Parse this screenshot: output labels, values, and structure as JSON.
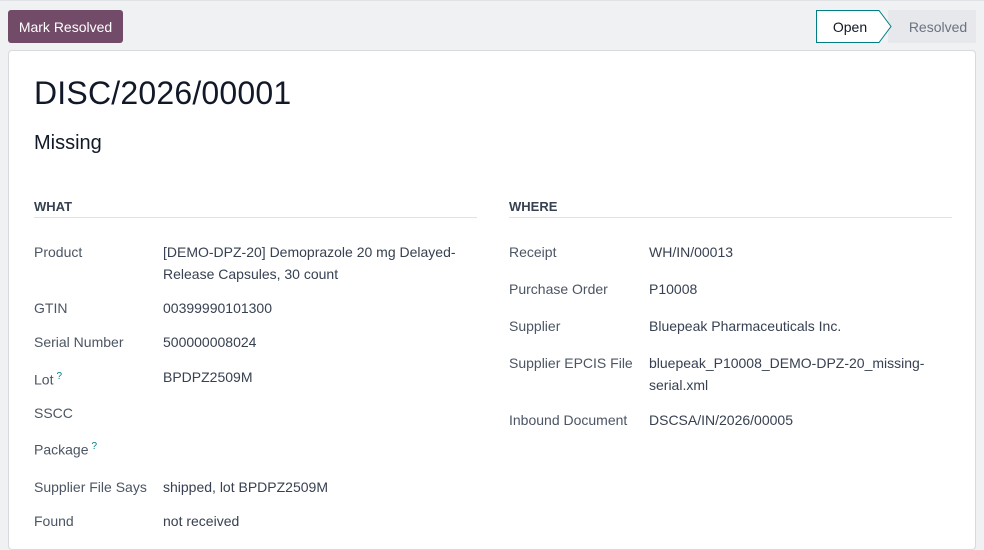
{
  "toolbar": {
    "mark_resolved_label": "Mark Resolved",
    "status": {
      "open": "Open",
      "resolved": "Resolved"
    }
  },
  "record": {
    "title": "DISC/2026/00001",
    "subtitle": "Missing"
  },
  "what": {
    "heading": "WHAT",
    "product_label": "Product",
    "product_value": "[DEMO-DPZ-20] Demoprazole 20 mg Delayed-Release Capsules, 30 count",
    "gtin_label": "GTIN",
    "gtin_value": "00399990101300",
    "serial_label": "Serial Number",
    "serial_value": "500000008024",
    "lot_label": "Lot",
    "lot_value": "BPDPZ2509M",
    "sscc_label": "SSCC",
    "sscc_value": "",
    "package_label": "Package",
    "package_value": "",
    "help_mark": "?",
    "supplier_says_label": "Supplier File Says",
    "supplier_says_value": "shipped, lot BPDPZ2509M",
    "found_label": "Found",
    "found_value": "not received"
  },
  "where": {
    "heading": "WHERE",
    "receipt_label": "Receipt",
    "receipt_value": "WH/IN/00013",
    "po_label": "Purchase Order",
    "po_value": "P10008",
    "supplier_label": "Supplier",
    "supplier_value": "Bluepeak Pharmaceuticals Inc.",
    "epcis_label": "Supplier EPCIS File",
    "epcis_value": "bluepeak_P10008_DEMO-DPZ-20_missing-serial.xml",
    "inbound_label": "Inbound Document",
    "inbound_value": "DSCSA/IN/2026/00005"
  },
  "colors": {
    "primary": "#714b67",
    "link": "#017e84",
    "status_active_border": "#017e84"
  }
}
